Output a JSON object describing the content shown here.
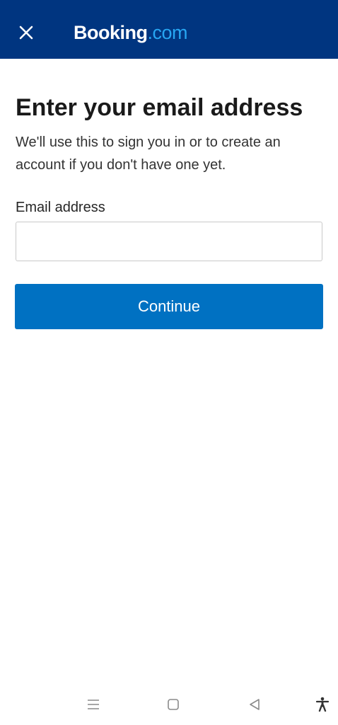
{
  "header": {
    "brand_main": "Booking",
    "brand_tld": ".com",
    "close_icon": "close-icon"
  },
  "main": {
    "title": "Enter your email address",
    "subtitle": "We'll use this to sign you in or to create an account if you don't have one yet.",
    "email_label": "Email address",
    "email_value": "",
    "continue_label": "Continue"
  },
  "system_nav": {
    "icons": [
      "recents-icon",
      "home-icon",
      "back-icon",
      "accessibility-icon"
    ]
  },
  "colors": {
    "header_bg": "#003580",
    "brand_accent": "#27a6f2",
    "primary_button": "#0071c2"
  }
}
